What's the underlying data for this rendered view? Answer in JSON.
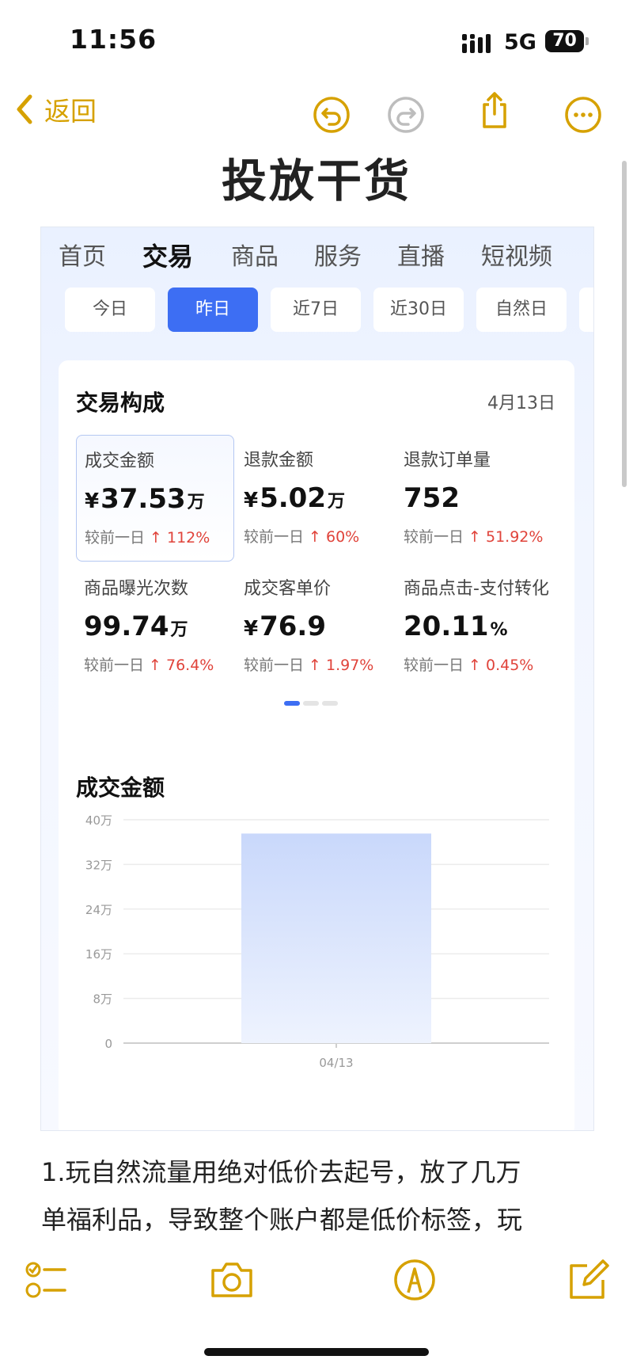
{
  "status_bar": {
    "time": "11:56",
    "network": "5G",
    "battery": "70"
  },
  "nav": {
    "back_label": "返回"
  },
  "note_title": "投放干货",
  "screenshot": {
    "tabs": [
      "首页",
      "交易",
      "商品",
      "服务",
      "直播",
      "短视频"
    ],
    "active_tab": "交易",
    "date_chips": [
      "今日",
      "昨日",
      "近7日",
      "近30日",
      "自然日"
    ],
    "active_chip": "昨日",
    "card": {
      "title": "交易构成",
      "date": "4月13日",
      "metrics": [
        {
          "label": "成交金额",
          "currency": "¥",
          "value": "37.53",
          "unit": "万",
          "compare": "较前一日",
          "delta": "112%"
        },
        {
          "label": "退款金额",
          "currency": "¥",
          "value": "5.02",
          "unit": "万",
          "compare": "较前一日",
          "delta": "60%"
        },
        {
          "label": "退款订单量",
          "currency": "",
          "value": "752",
          "unit": "",
          "compare": "较前一日",
          "delta": "51.92%"
        },
        {
          "label": "商品曝光次数",
          "currency": "",
          "value": "99.74",
          "unit": "万",
          "compare": "较前一日",
          "delta": "76.4%"
        },
        {
          "label": "成交客单价",
          "currency": "¥",
          "value": "76.9",
          "unit": "",
          "compare": "较前一日",
          "delta": "1.97%"
        },
        {
          "label": "商品点击-支付转化",
          "currency": "",
          "value": "20.11",
          "unit": "%",
          "compare": "较前一日",
          "delta": "0.45%"
        }
      ]
    },
    "chart_title": "成交金额"
  },
  "chart_data": {
    "type": "bar",
    "title": "成交金额",
    "categories": [
      "04/13"
    ],
    "values": [
      375300
    ],
    "y_ticks": [
      "0",
      "8万",
      "16万",
      "24万",
      "32万",
      "40万"
    ],
    "ylim": [
      0,
      400000
    ],
    "grid": true,
    "bar_color": "#c9d8fb"
  },
  "body_text": {
    "line1": "1.玩自然流量用绝对低价去起号，放了几万",
    "line2": "单福利品，导致整个账户都是低价标签，玩"
  },
  "colors": {
    "accent": "#d6a100",
    "brand_blue": "#3d6ef3",
    "up_red": "#e0433a"
  }
}
